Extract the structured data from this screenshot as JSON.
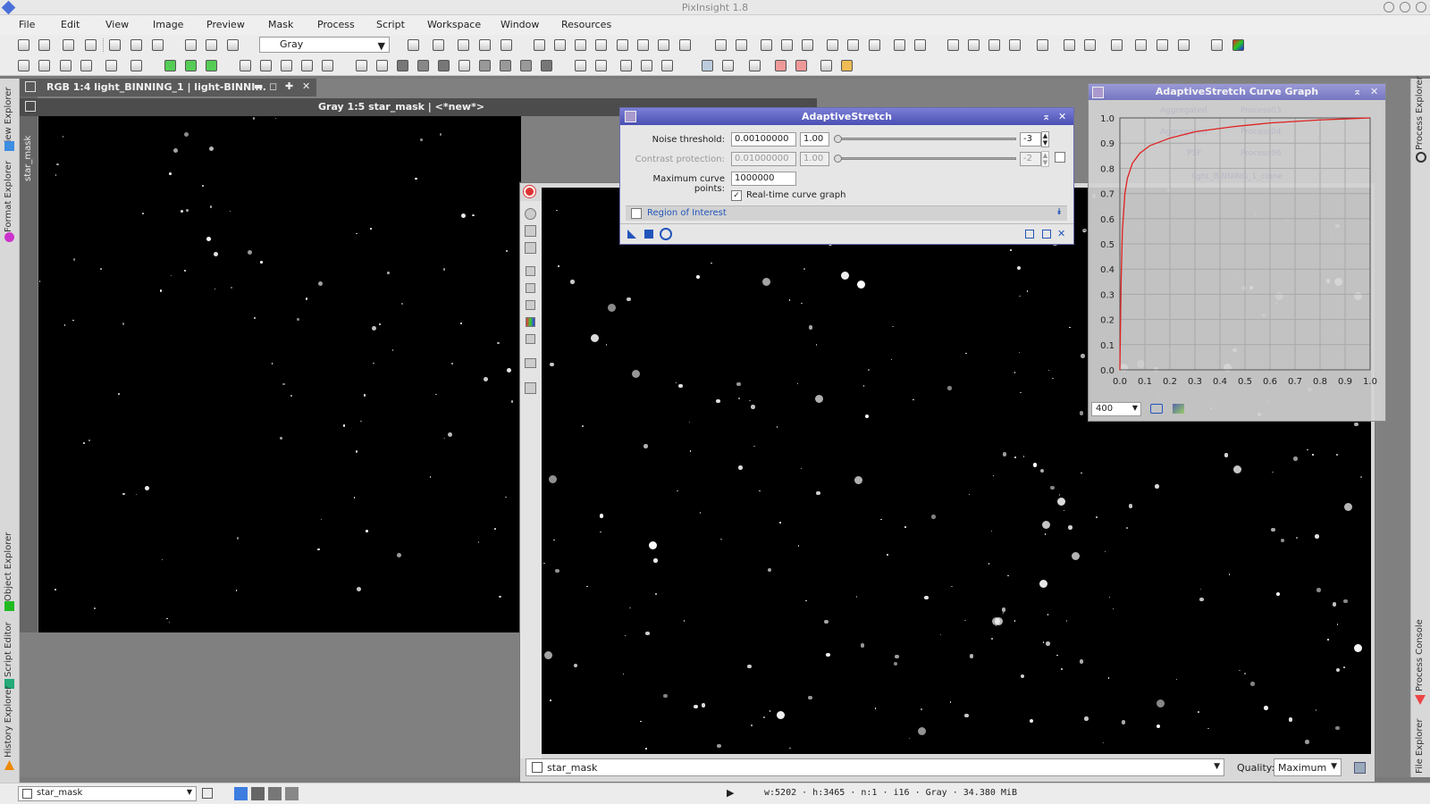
{
  "app": {
    "title": "PixInsight 1.8"
  },
  "menu": [
    "File",
    "Edit",
    "View",
    "Image",
    "Preview",
    "Mask",
    "Process",
    "Script",
    "Workspace",
    "Window",
    "Resources"
  ],
  "toolbar": {
    "channel_combo": "Gray"
  },
  "left_dock": [
    "View Explorer",
    "Format Explorer",
    "Object Explorer",
    "Script Editor",
    "History Explorer"
  ],
  "right_dock": [
    "Process Explorer",
    "Process Console",
    "File Explorer"
  ],
  "windows": {
    "rgb": {
      "title": "RGB 1:4 light_BINNING_1 | light-BINNI...",
      "side_tab": "star_mask"
    },
    "gray": {
      "title": "Gray 1:5 star_mask | <*new*>"
    },
    "front": {
      "view_combo": "star_mask",
      "quality_label": "Quality:",
      "quality_value": "Maximum"
    }
  },
  "adaptive_stretch": {
    "title": "AdaptiveStretch",
    "noise_label": "Noise threshold:",
    "noise_value": "0.00100000",
    "noise_mantissa": "1.00",
    "noise_exp": "-3",
    "contrast_label": "Contrast protection:",
    "contrast_value": "0.01000000",
    "contrast_mantissa": "1.00",
    "contrast_exp": "-2",
    "points_label": "Maximum curve points:",
    "points_value": "1000000",
    "realtime_label": "Real-time curve graph",
    "roi_label": "Region of Interest"
  },
  "curve_graph": {
    "title": "AdaptiveStretch Curve Graph",
    "zoom_value": "400",
    "y_ticks": [
      "1.0",
      "0.9",
      "0.8",
      "0.7",
      "0.6",
      "0.5",
      "0.4",
      "0.3",
      "0.2",
      "0.1",
      "0.0"
    ],
    "x_ticks": [
      "0.0",
      "0.1",
      "0.2",
      "0.3",
      "0.4",
      "0.5",
      "0.6",
      "0.7",
      "0.8",
      "0.9",
      "1.0"
    ],
    "ghost_labels": [
      "Aggregated",
      "Process03",
      "Aggregated",
      "Process04",
      "PSF",
      "Process06",
      "light_BINNING_1_clone"
    ]
  },
  "chart_data": {
    "type": "line",
    "xlim": [
      0,
      1
    ],
    "ylim": [
      0,
      1
    ],
    "series": [
      {
        "x": [
          0,
          0.005,
          0.01,
          0.02,
          0.03,
          0.05,
          0.08,
          0.12,
          0.2,
          0.3,
          0.45,
          0.6,
          0.8,
          1.0
        ],
        "y": [
          0,
          0.35,
          0.55,
          0.7,
          0.76,
          0.82,
          0.86,
          0.89,
          0.92,
          0.945,
          0.965,
          0.98,
          0.992,
          1.0
        ]
      }
    ],
    "grid": true
  },
  "status": {
    "view": "star_mask",
    "info": "w:5202 · h:3465 · n:1 · i16 · Gray · 34.380 MiB"
  }
}
